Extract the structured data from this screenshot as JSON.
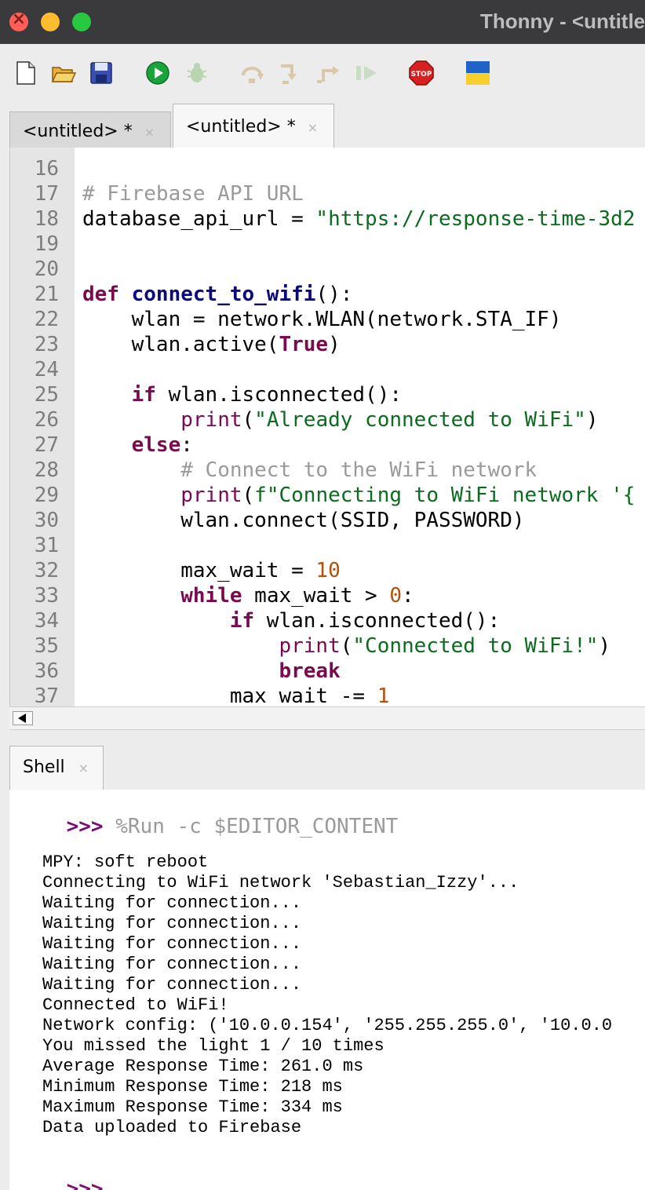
{
  "window": {
    "title": "Thonny  -  <untitled>"
  },
  "toolbar": {
    "icons": [
      "new-file-icon",
      "open-file-icon",
      "save-icon",
      "run-icon",
      "debug-icon",
      "step-over-icon",
      "step-into-icon",
      "step-out-icon",
      "resume-icon",
      "stop-icon",
      "ukraine-flag-icon"
    ],
    "stop_label": "STOP",
    "colors": {
      "run": "#1aa33a",
      "stop": "#d92020",
      "flag_blue": "#1f63c7",
      "flag_yellow": "#f7d02c"
    }
  },
  "editor_tabs": [
    {
      "label": "<untitled> *",
      "close": "×"
    },
    {
      "label": "<untitled> *",
      "close": "×"
    }
  ],
  "editor": {
    "lines": [
      {
        "n": "16",
        "html": ""
      },
      {
        "n": "17",
        "html": "<span class='cmt'># Firebase API URL</span>"
      },
      {
        "n": "18",
        "html": "database_api_url = <span class='str'>\"https://response-time-3d2</span>"
      },
      {
        "n": "19",
        "html": ""
      },
      {
        "n": "20",
        "html": ""
      },
      {
        "n": "21",
        "html": "<span class='kw'>def</span> <span class='fn'>connect_to_wifi</span>():"
      },
      {
        "n": "22",
        "html": "    wlan = network.WLAN(network.STA_IF)"
      },
      {
        "n": "23",
        "html": "    wlan.active(<span class='kw'>True</span>)"
      },
      {
        "n": "24",
        "html": ""
      },
      {
        "n": "25",
        "html": "    <span class='kw'>if</span> wlan.isconnected():"
      },
      {
        "n": "26",
        "html": "        <span class='bi'>print</span>(<span class='str'>\"Already connected to WiFi\"</span>)"
      },
      {
        "n": "27",
        "html": "    <span class='kw'>else</span>:"
      },
      {
        "n": "28",
        "html": "        <span class='cmt'># Connect to the WiFi network</span>"
      },
      {
        "n": "29",
        "html": "        <span class='bi'>print</span>(<span class='str'>f\"Connecting to WiFi network '{</span>"
      },
      {
        "n": "30",
        "html": "        wlan.connect(SSID, PASSWORD)"
      },
      {
        "n": "31",
        "html": ""
      },
      {
        "n": "32",
        "html": "        max_wait = <span class='num-lit'>10</span>"
      },
      {
        "n": "33",
        "html": "        <span class='kw'>while</span> max_wait &gt; <span class='num-lit'>0</span>:"
      },
      {
        "n": "34",
        "html": "            <span class='kw'>if</span> wlan.isconnected():"
      },
      {
        "n": "35",
        "html": "                <span class='bi'>print</span>(<span class='str'>\"Connected to WiFi!\"</span>)"
      },
      {
        "n": "36",
        "html": "                <span class='kw'>break</span>"
      },
      {
        "n": "37",
        "html": "            max_wait -= <span class='num-lit'>1</span>"
      }
    ]
  },
  "shell": {
    "tab_label": "Shell",
    "tab_close": "×",
    "prompt": ">>>",
    "command": " %Run -c $EDITOR_CONTENT",
    "output": [
      "MPY: soft reboot",
      "Connecting to WiFi network 'Sebastian_Izzy'...",
      "Waiting for connection...",
      "Waiting for connection...",
      "Waiting for connection...",
      "Waiting for connection...",
      "Waiting for connection...",
      "Connected to WiFi!",
      "Network config: ('10.0.0.154', '255.255.255.0', '10.0.0",
      "You missed the light 1 / 10 times",
      "Average Response Time: 261.0 ms",
      "Minimum Response Time: 218 ms",
      "Maximum Response Time: 334 ms",
      "Data uploaded to Firebase"
    ],
    "final_prompt": ">>>"
  }
}
